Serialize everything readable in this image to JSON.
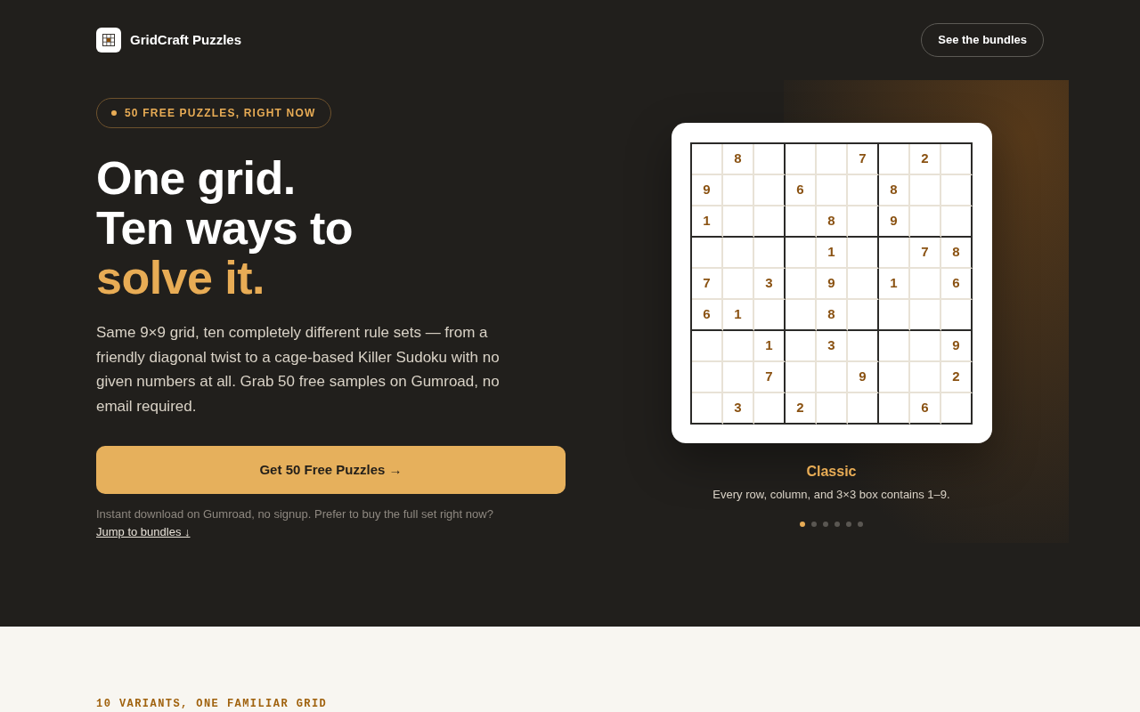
{
  "header": {
    "brand": "GridCraft Puzzles",
    "button": "See the bundles"
  },
  "hero": {
    "badge": "50 FREE PUZZLES, RIGHT NOW",
    "headline": [
      {
        "text": "One grid.",
        "accent": false
      },
      {
        "text": "Ten ways to",
        "accent": false
      },
      {
        "text": "solve it.",
        "accent": true
      }
    ],
    "description": "Same 9×9 grid, ten completely different rule sets — from a friendly diagonal twist to a cage-based Killer Sudoku with no given numbers at all. Grab 50 free samples on Gumroad, no email required.",
    "cta": "Get 50 Free Puzzles →",
    "note": "Instant download on Gumroad, no signup. Prefer to buy the full set right now?",
    "note_link": "Jump to bundles ↓"
  },
  "preview": {
    "grid": [
      [
        {
          "kind": "empty"
        },
        {
          "kind": "given",
          "value": "8"
        },
        {
          "kind": "empty"
        },
        {
          "kind": "empty"
        },
        {
          "kind": "empty"
        },
        {
          "kind": "given",
          "value": "7"
        },
        {
          "kind": "empty"
        },
        {
          "kind": "given",
          "value": "2"
        },
        {
          "kind": "empty"
        }
      ],
      [
        {
          "kind": "given",
          "value": "9"
        },
        {
          "kind": "empty"
        },
        {
          "kind": "empty"
        },
        {
          "kind": "given",
          "value": "6"
        },
        {
          "kind": "empty"
        },
        {
          "kind": "empty"
        },
        {
          "kind": "given",
          "value": "8"
        },
        {
          "kind": "empty"
        },
        {
          "kind": "empty"
        }
      ],
      [
        {
          "kind": "given",
          "value": "1"
        },
        {
          "kind": "empty"
        },
        {
          "kind": "empty"
        },
        {
          "kind": "empty"
        },
        {
          "kind": "given",
          "value": "8"
        },
        {
          "kind": "empty"
        },
        {
          "kind": "given",
          "value": "9"
        },
        {
          "kind": "empty"
        },
        {
          "kind": "empty"
        }
      ],
      [
        {
          "kind": "empty"
        },
        {
          "kind": "empty"
        },
        {
          "kind": "empty"
        },
        {
          "kind": "empty"
        },
        {
          "kind": "given",
          "value": "1"
        },
        {
          "kind": "empty"
        },
        {
          "kind": "empty"
        },
        {
          "kind": "given",
          "value": "7"
        },
        {
          "kind": "given",
          "value": "8"
        }
      ],
      [
        {
          "kind": "given",
          "value": "7"
        },
        {
          "kind": "empty"
        },
        {
          "kind": "given",
          "value": "3"
        },
        {
          "kind": "empty"
        },
        {
          "kind": "given",
          "value": "9"
        },
        {
          "kind": "empty"
        },
        {
          "kind": "given",
          "value": "1"
        },
        {
          "kind": "empty"
        },
        {
          "kind": "given",
          "value": "6"
        }
      ],
      [
        {
          "kind": "given",
          "value": "6"
        },
        {
          "kind": "given",
          "value": "1"
        },
        {
          "kind": "empty"
        },
        {
          "kind": "empty"
        },
        {
          "kind": "given",
          "value": "8"
        },
        {
          "kind": "empty"
        },
        {
          "kind": "empty"
        },
        {
          "kind": "empty"
        },
        {
          "kind": "empty"
        }
      ],
      [
        {
          "kind": "empty"
        },
        {
          "kind": "empty"
        },
        {
          "kind": "given",
          "value": "1"
        },
        {
          "kind": "empty"
        },
        {
          "kind": "given",
          "value": "3"
        },
        {
          "kind": "empty"
        },
        {
          "kind": "empty"
        },
        {
          "kind": "empty"
        },
        {
          "kind": "given",
          "value": "9"
        }
      ],
      [
        {
          "kind": "empty"
        },
        {
          "kind": "empty"
        },
        {
          "kind": "given",
          "value": "7"
        },
        {
          "kind": "empty"
        },
        {
          "kind": "empty"
        },
        {
          "kind": "given",
          "value": "9"
        },
        {
          "kind": "empty"
        },
        {
          "kind": "empty"
        },
        {
          "kind": "given",
          "value": "2"
        }
      ],
      [
        {
          "kind": "empty"
        },
        {
          "kind": "given",
          "value": "3"
        },
        {
          "kind": "empty"
        },
        {
          "kind": "given",
          "value": "2"
        },
        {
          "kind": "empty"
        },
        {
          "kind": "empty"
        },
        {
          "kind": "empty"
        },
        {
          "kind": "given",
          "value": "6"
        },
        {
          "kind": "empty"
        }
      ]
    ],
    "title": "Classic",
    "caption": "Every row, column, and 3×3 box contains 1–9.",
    "slides": [
      {
        "selected": true
      },
      {
        "selected": false
      },
      {
        "selected": false
      },
      {
        "selected": false
      },
      {
        "selected": false
      },
      {
        "selected": false
      }
    ]
  },
  "variants_section": {
    "eyebrow": "10 VARIANTS, ONE FAMILIAR GRID"
  }
}
